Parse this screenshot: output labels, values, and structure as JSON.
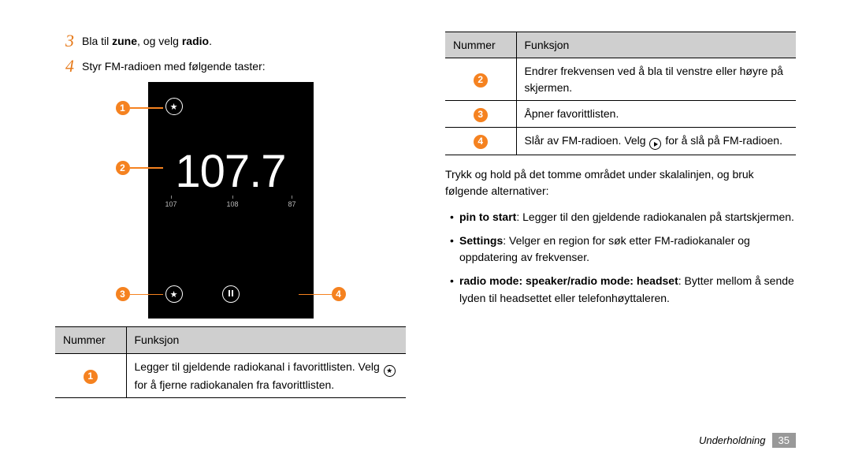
{
  "steps": {
    "s3_pre": "Bla til ",
    "s3_b1": "zune",
    "s3_mid": ", og velg ",
    "s3_b2": "radio",
    "s3_post": ".",
    "s4": "Styr FM-radioen med følgende taster:"
  },
  "stepnums": {
    "n3": "3",
    "n4": "4"
  },
  "phone": {
    "freq": "107.7",
    "scale": {
      "a": "107",
      "b": "108",
      "c": "87"
    },
    "star_glyph": "★"
  },
  "callouts": {
    "c1": "1",
    "c2": "2",
    "c3": "3",
    "c4": "4"
  },
  "table_left": {
    "h1": "Nummer",
    "h2": "Funksjon",
    "r1_num": "1",
    "r1_a": "Legger til gjeldende radiokanal i favorittlisten. Velg ",
    "r1_b": " for å fjerne radiokanalen fra favorittlisten.",
    "star_glyph": "★"
  },
  "table_right": {
    "h1": "Nummer",
    "h2": "Funksjon",
    "r2_num": "2",
    "r2": "Endrer frekvensen ved å bla til venstre eller høyre på skjermen.",
    "r3_num": "3",
    "r3": "Åpner favorittlisten.",
    "r4_num": "4",
    "r4_a": "Slår av FM-radioen. Velg ",
    "r4_b": " for å slå på FM-radioen."
  },
  "para": "Trykk og hold på det tomme området under skalalinjen, og bruk følgende alternativer:",
  "opts": {
    "o1_b": "pin to start",
    "o1_t": ": Legger til den gjeldende radiokanalen på startskjermen.",
    "o2_b": "Settings",
    "o2_t": ": Velger en region for søk etter FM-radiokanaler og oppdatering av frekvenser.",
    "o3_b": "radio mode: speaker/radio mode: headset",
    "o3_t": ": Bytter mellom å sende lyden til headsettet eller telefonhøyttaleren."
  },
  "footer": {
    "section": "Underholdning",
    "page": "35"
  }
}
